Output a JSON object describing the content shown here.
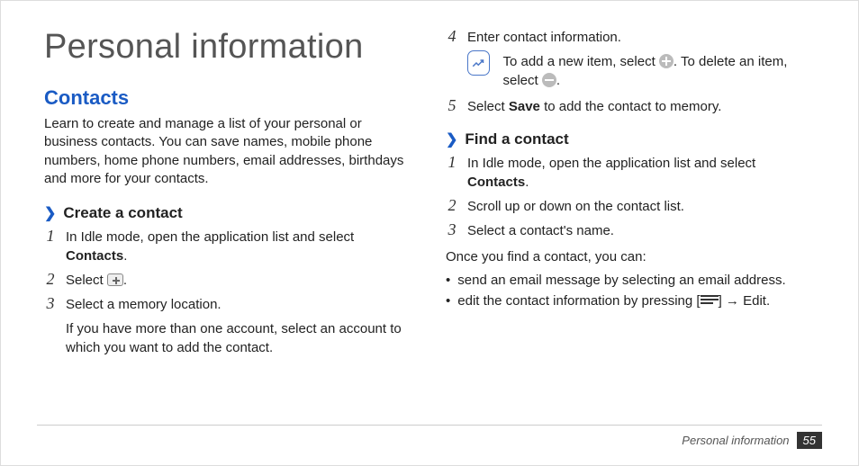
{
  "title": "Personal information",
  "contacts": {
    "heading": "Contacts",
    "intro": "Learn to create and manage a list of your personal or business contacts. You can save names, mobile phone numbers, home phone numbers, email addresses, birthdays and more for your contacts."
  },
  "create": {
    "heading": "Create a contact",
    "step1_a": "In Idle mode, open the application list and select ",
    "step1_b": "Contacts",
    "step1_c": ".",
    "step2_a": "Select ",
    "step2_b": ".",
    "step3": "Select a memory location.",
    "step3_note": "If you have more than one account, select an account to which you want to add the contact."
  },
  "right": {
    "step4": "Enter contact information.",
    "note_a": "To add a new item, select ",
    "note_b": ". To delete an item, select ",
    "note_c": ".",
    "step5_a": "Select ",
    "step5_b": "Save",
    "step5_c": " to add the contact to memory."
  },
  "find": {
    "heading": "Find a contact",
    "step1_a": "In Idle mode, open the application list and select ",
    "step1_b": "Contacts",
    "step1_c": ".",
    "step2": "Scroll up or down on the contact list.",
    "step3": "Select a contact's name.",
    "after": "Once you find a contact, you can:",
    "bullet1": "send an email message by selecting an email address.",
    "bullet2_a": "edit the contact information by pressing [",
    "bullet2_b": "] → ",
    "bullet2_c": "Edit",
    "bullet2_d": "."
  },
  "footer": {
    "label": "Personal information",
    "page": "55"
  }
}
